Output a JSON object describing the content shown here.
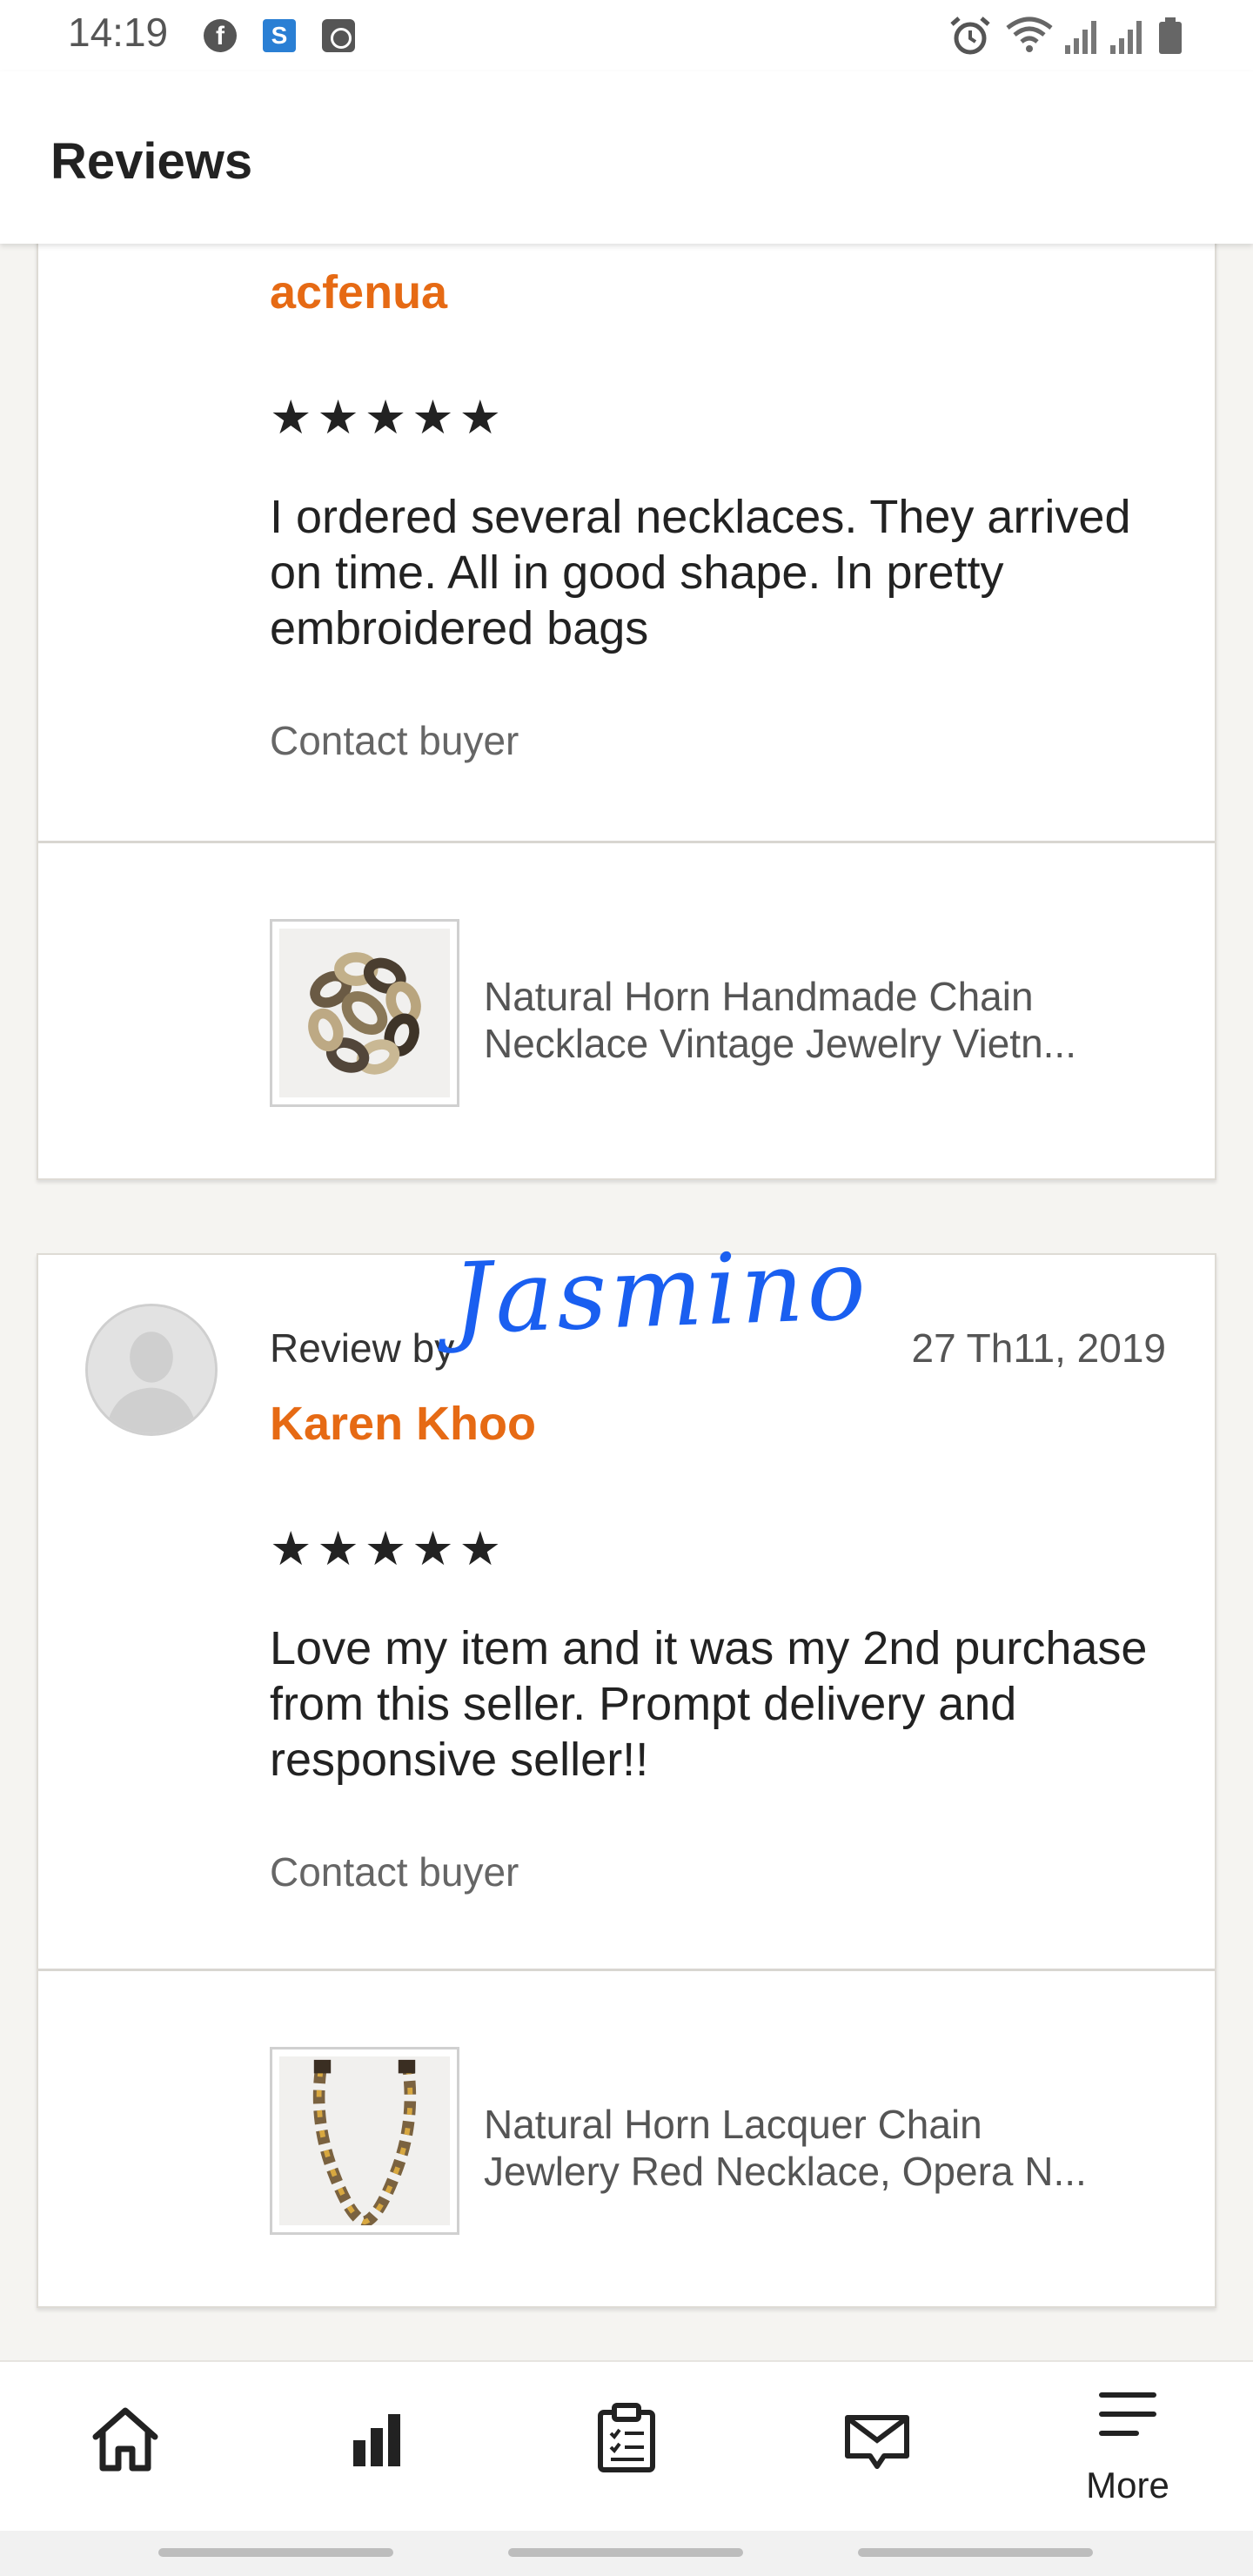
{
  "status_bar": {
    "time": "14:19",
    "left_icons": [
      "facebook-icon",
      "s-app-icon",
      "clock-app-icon"
    ],
    "right_icons": [
      "alarm-icon",
      "wifi-icon",
      "signal-icon",
      "signal-icon",
      "battery-icon"
    ],
    "fb_glyph": "f",
    "s_glyph": "S"
  },
  "header": {
    "title": "Reviews"
  },
  "reviews": [
    {
      "reviewer": "acfenua",
      "stars": "★★★★★",
      "rating": 5,
      "text": "I ordered several necklaces.  They arrived on time.  All in good shape. In pretty embroidered bags",
      "contact_label": "Contact buyer",
      "listing_line1": "Natural Horn Handmade Chain",
      "listing_line2": "Necklace Vintage Jewelry Vietn..."
    },
    {
      "review_by_label": "Review by",
      "date": "27 Th11, 2019",
      "reviewer": "Karen Khoo",
      "stars": "★★★★★",
      "rating": 5,
      "text": "Love my item and it was my 2nd purchase from this seller. Prompt delivery and responsive seller!!",
      "contact_label": "Contact buyer",
      "listing_line1": "Natural Horn Lacquer Chain",
      "listing_line2": "Jewlery Red Necklace, Opera N..."
    }
  ],
  "signature_text": "Jasmino",
  "bottom_nav": {
    "items": [
      "home-icon",
      "stats-icon",
      "orders-icon",
      "messages-icon",
      "more-menu-icon"
    ],
    "more_label": "More"
  },
  "colors": {
    "accent": "#e66a14",
    "signature": "#1a5ff0"
  }
}
